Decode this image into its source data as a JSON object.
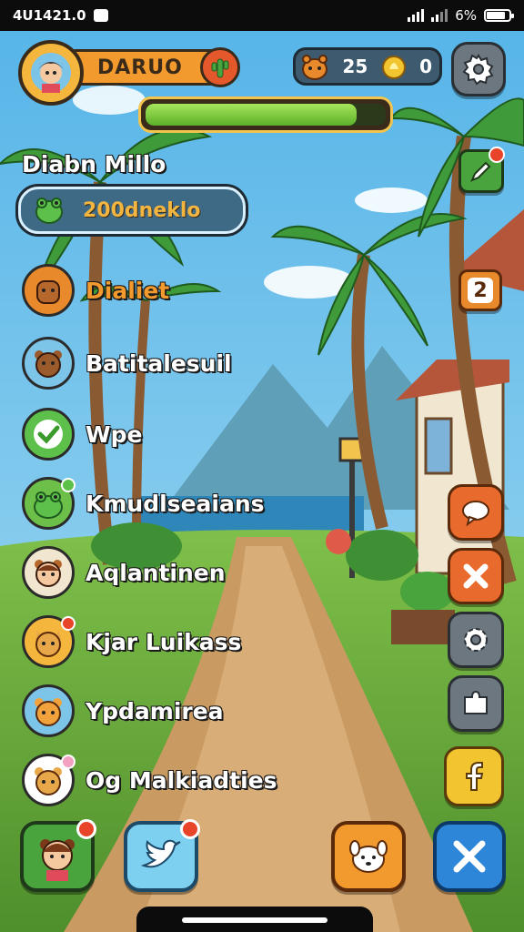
{
  "status_bar": {
    "time": "4U1421.0",
    "battery": "6%",
    "notification_icon": "message-icon",
    "signal_icon": "signal-bars-icon"
  },
  "player": {
    "name_tag": "DARUO",
    "avatar_icon": "player-avatar-icon",
    "badge_icon": "cactus-badge-icon",
    "progress_fraction": 0.88,
    "title": "Diabn Millo",
    "score_label": "200dneklo"
  },
  "currency": {
    "pets": "25",
    "coins": "0"
  },
  "right_side": {
    "level_badge": "2"
  },
  "friends": [
    {
      "name": "Dialiet",
      "color": "orange",
      "avatar": "dog-avatar-icon"
    },
    {
      "name": "Batitalesuil",
      "color": "white",
      "avatar": "bear-avatar-icon"
    },
    {
      "name": "Wpe",
      "color": "white",
      "avatar": "checkmark-icon"
    },
    {
      "name": "Kmudlseaians",
      "color": "white",
      "avatar": "frog-avatar-icon"
    },
    {
      "name": "Aqlantinen",
      "color": "white",
      "avatar": "bear-girl-avatar-icon"
    },
    {
      "name": "Kjar Luikass",
      "color": "white",
      "avatar": "cat-avatar-icon"
    },
    {
      "name": "Ypdamirea",
      "color": "white",
      "avatar": "tiger-avatar-icon"
    },
    {
      "name": "Og Malkiadties",
      "color": "white",
      "avatar": "bear-cub-avatar-icon"
    }
  ],
  "colors": {
    "accent_orange": "#f29a2e",
    "progress_green": "#7cd43a",
    "sky": "#6ec3ea",
    "path": "#c99a62"
  }
}
